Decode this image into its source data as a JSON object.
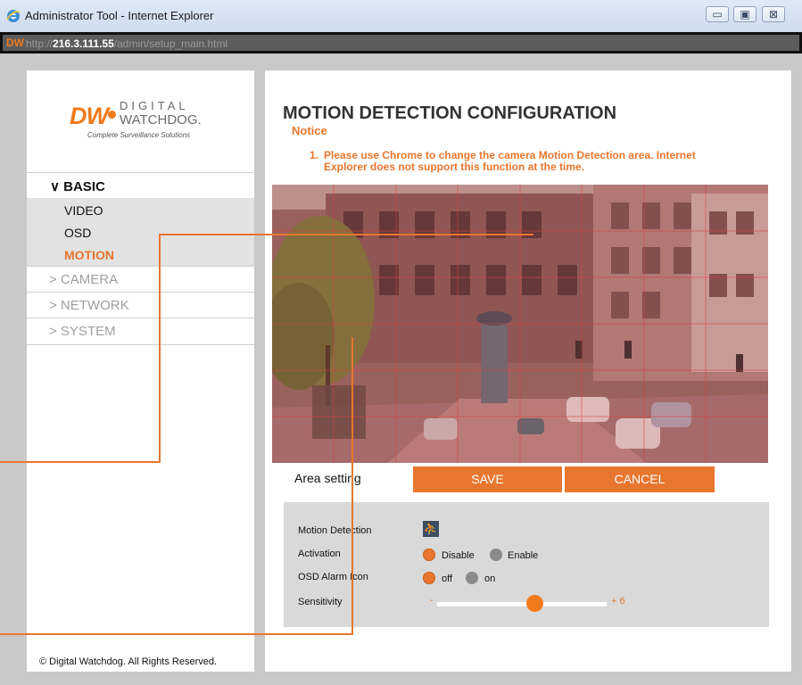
{
  "window": {
    "title": "Administrator Tool - Internet Explorer",
    "address_prefix": "http://",
    "address_host": "216.3.111.55",
    "address_path": "/admin/setup_main.html",
    "address_icon_text": "DW",
    "buttons": {
      "minimize": "▭",
      "maximize": "▣",
      "close": "⊠"
    }
  },
  "logo": {
    "mark": "DW",
    "line1": "DIGITAL",
    "line2": "WATCHDOG.",
    "tagline": "Complete Surveillance Solutions"
  },
  "sidebar": {
    "basic_label": "∨ BASIC",
    "subitems": [
      {
        "label": "VIDEO",
        "active": false
      },
      {
        "label": "OSD",
        "active": false
      },
      {
        "label": "MOTION",
        "active": true
      }
    ],
    "items": [
      {
        "label": "> CAMERA"
      },
      {
        "label": "> NETWORK"
      },
      {
        "label": "> SYSTEM"
      }
    ],
    "copyright": "© Digital Watchdog. All Rights Reserved."
  },
  "main": {
    "title": "MOTION DETECTION CONFIGURATION",
    "notice_heading": "Notice",
    "notice_number": "1.",
    "notice_text": "Please use Chrome to change the camera Motion Detection area. Internet Explorer does not support this function at the time.",
    "area_setting_label": "Area setting",
    "save_label": "SAVE",
    "cancel_label": "CANCEL"
  },
  "settings": {
    "motion_detection_label": "Motion Detection",
    "motion_icon": "running-person-icon",
    "activation_label": "Activation",
    "activation_options": [
      "Disable",
      "Enable"
    ],
    "activation_selected": "Disable",
    "osd_alarm_label": "OSD Alarm Icon",
    "osd_alarm_options": [
      "off",
      "on"
    ],
    "osd_alarm_selected": "off",
    "sensitivity_label": "Sensitivity",
    "sensitivity_min_symbol": "-",
    "sensitivity_max_symbol": "+",
    "sensitivity_value": "6"
  },
  "colors": {
    "accent": "#e8762e",
    "frame": "#c9c9c9",
    "settings_bg": "#d9d9d9"
  }
}
